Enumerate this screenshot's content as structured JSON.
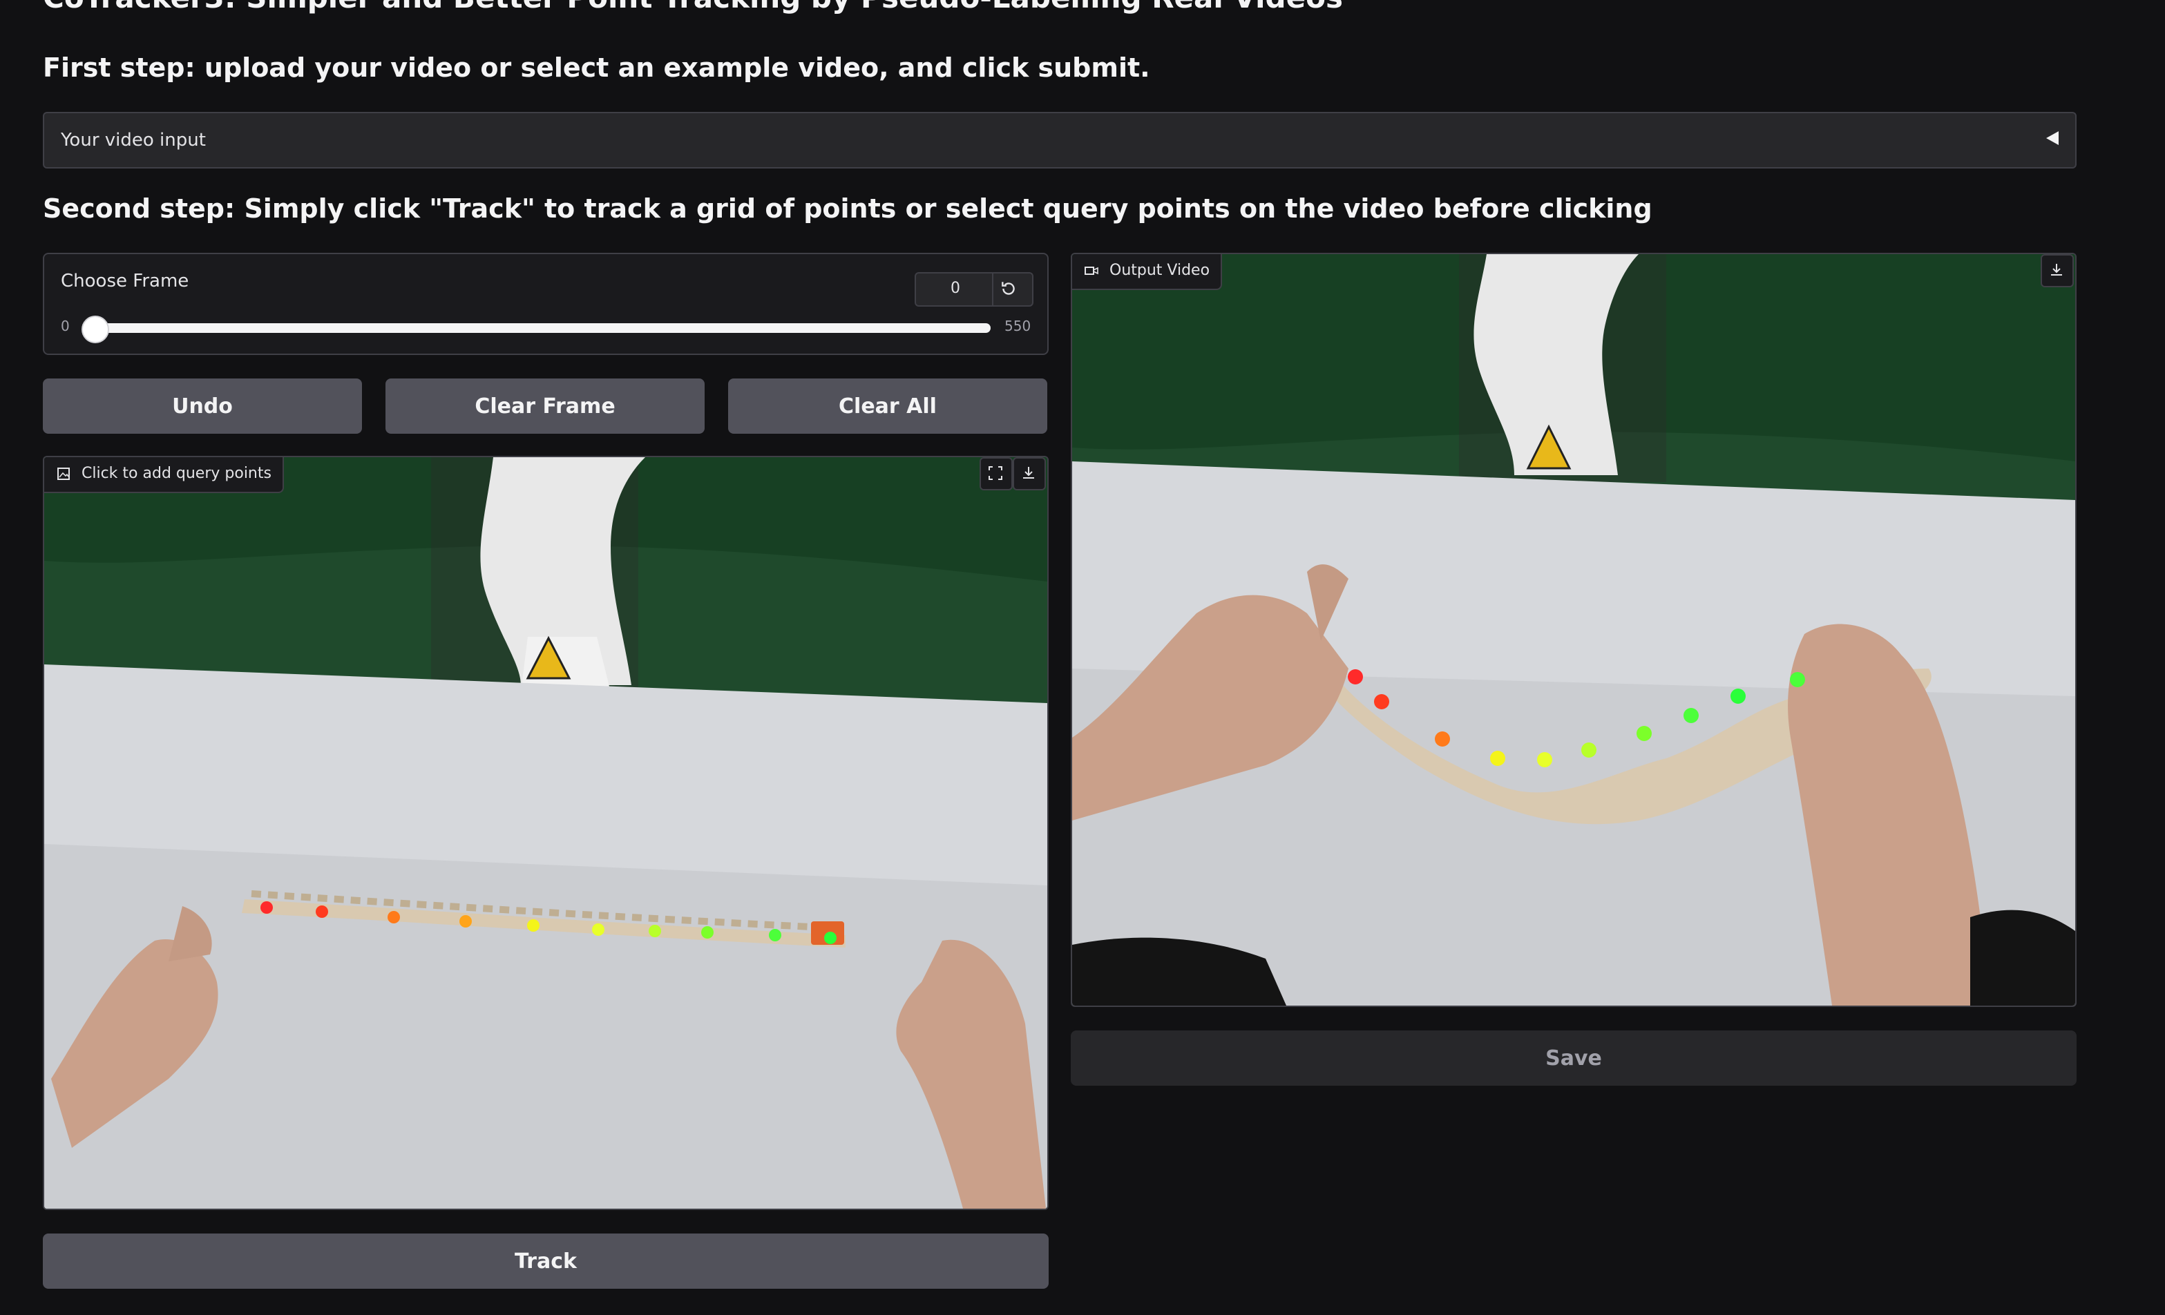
{
  "page_title": "CoTracker3: Simpler and Better Point Tracking by Pseudo-Labelling Real Videos",
  "step1": "First step: upload your video or select an example video, and click submit.",
  "video_input": {
    "label": "Your video input",
    "state": "collapsed"
  },
  "step2": "Second step: Simply click \"Track\" to track a grid of points or select query points on the video before clicking",
  "frame_slider": {
    "label": "Choose Frame",
    "value": "0",
    "min": "0",
    "max": "550",
    "reset_icon": "reset-icon"
  },
  "buttons": {
    "undo": "Undo",
    "clear_frame": "Clear Frame",
    "clear_all": "Clear All",
    "track": "Track",
    "save": "Save"
  },
  "query_image": {
    "label": "Click to add query points",
    "icons": [
      "image-icon",
      "fullscreen-icon",
      "download-icon"
    ]
  },
  "output_video": {
    "label": "Output Video",
    "icons": [
      "video-icon",
      "download-icon"
    ]
  },
  "colors": {
    "background": "#111113",
    "panel": "#27272a",
    "button": "#52525b",
    "border": "#3f3f46",
    "point_colors": [
      "#ff2a2a",
      "#ff3b1f",
      "#ff7a1a",
      "#ffa41a",
      "#f4f41a",
      "#e8ff2a",
      "#b8ff2a",
      "#7cff2a",
      "#4cff3a",
      "#2aff3a"
    ]
  }
}
